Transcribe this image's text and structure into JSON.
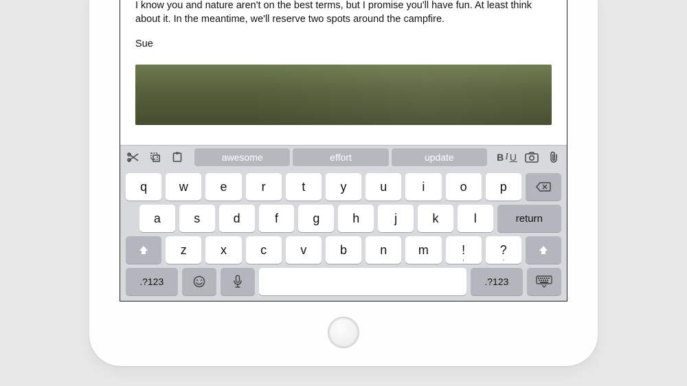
{
  "email": {
    "body": "I know you and nature aren't on the best terms, but I promise you'll have fun. At least think about it. In the meantime, we'll reserve two spots around the campfire.",
    "signoff": "Sue"
  },
  "toolbar": {
    "format_b": "B",
    "format_i": "I",
    "format_u": "U"
  },
  "suggestions": [
    "awesome",
    "effort",
    "update"
  ],
  "keys": {
    "row1": [
      "q",
      "w",
      "e",
      "r",
      "t",
      "y",
      "u",
      "i",
      "o",
      "p"
    ],
    "row2": [
      "a",
      "s",
      "d",
      "f",
      "g",
      "h",
      "j",
      "k",
      "l"
    ],
    "row3": [
      "z",
      "x",
      "c",
      "v",
      "b",
      "n",
      "m"
    ],
    "punct1_top": "!",
    "punct1_bot": ",",
    "punct2_top": "?",
    "punct2_bot": ".",
    "return": "return",
    "mode": ".?123"
  }
}
